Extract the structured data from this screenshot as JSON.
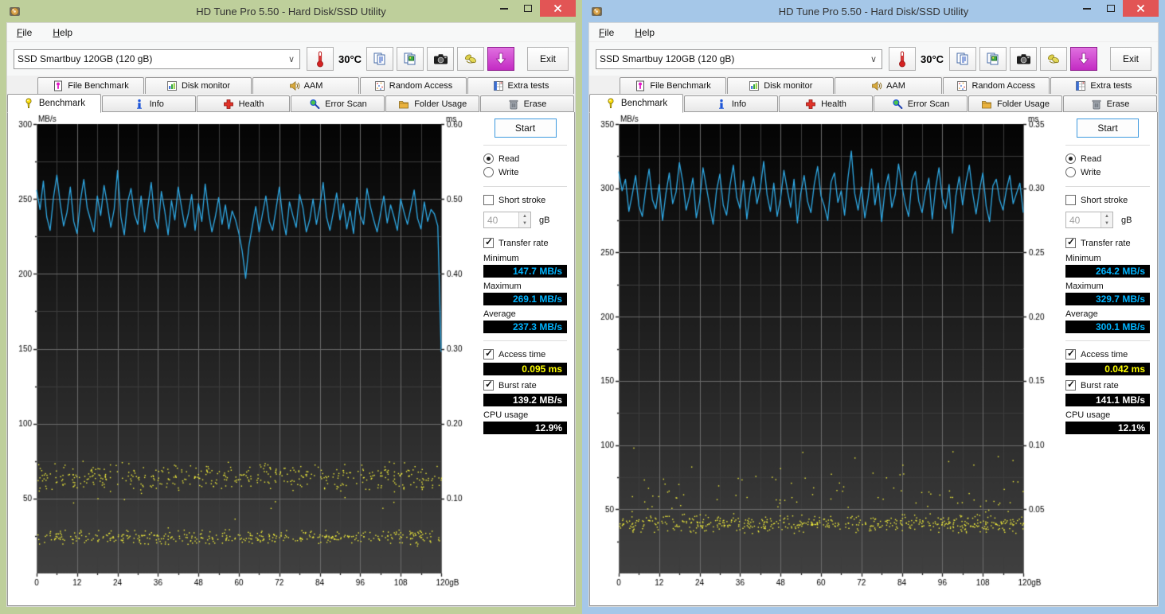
{
  "windows": [
    {
      "frame_color": "#becf9b",
      "title": "HD Tune Pro 5.50 - Hard Disk/SSD Utility",
      "menu": {
        "items": [
          {
            "label": "File"
          },
          {
            "label": "Help"
          }
        ]
      },
      "toolbar": {
        "drive_select": "SSD Smartbuy 120GB (120 gB)",
        "temperature": "30°C",
        "exit_label": "Exit"
      },
      "tabs_row1": [
        {
          "label": "File Benchmark"
        },
        {
          "label": "Disk monitor"
        },
        {
          "label": "AAM"
        },
        {
          "label": "Random Access"
        },
        {
          "label": "Extra tests"
        }
      ],
      "tabs_row2": [
        {
          "label": "Benchmark"
        },
        {
          "label": "Info"
        },
        {
          "label": "Health"
        },
        {
          "label": "Error Scan"
        },
        {
          "label": "Folder Usage"
        },
        {
          "label": "Erase"
        }
      ],
      "controls": {
        "start_label": "Start",
        "read_label": "Read",
        "write_label": "Write",
        "short_stroke_label": "Short stroke",
        "short_stroke_value": "40",
        "short_stroke_unit": "gB",
        "transfer_rate_label": "Transfer rate",
        "minimum_label": "Minimum",
        "minimum_value": "147.7 MB/s",
        "maximum_label": "Maximum",
        "maximum_value": "269.1 MB/s",
        "average_label": "Average",
        "average_value": "237.3 MB/s",
        "access_time_label": "Access time",
        "access_time_value": "0.095 ms",
        "burst_rate_label": "Burst rate",
        "burst_rate_value": "139.2 MB/s",
        "cpu_usage_label": "CPU usage",
        "cpu_usage_value": "12.9%"
      },
      "chart_data": {
        "type": "line+scatter",
        "x_unit": "gB",
        "x_max": 120,
        "x_ticks": [
          0,
          12,
          24,
          36,
          48,
          60,
          72,
          84,
          96,
          108,
          120
        ],
        "x_minor_step": 6,
        "y_left_label": "MB/s",
        "y_left_max": 300,
        "y_left_tick_step": 50,
        "y_left_minor_step": 25,
        "y_right_label": "ms",
        "y_right_max": 0.6,
        "y_right_ticks": [
          0.1,
          0.2,
          0.3,
          0.4,
          0.5,
          0.6
        ],
        "line_color": "#2fa9e5",
        "scatter_color": "#f5f13a",
        "seed": 11,
        "series": [
          {
            "name": "transfer-rate",
            "axis": "left",
            "x_step_gb": 1,
            "values": [
              256,
              243,
              262,
              238,
              229,
              251,
              266,
              247,
              232,
              241,
              258,
              235,
              227,
              249,
              263,
              244,
              236,
              228,
              252,
              239,
              259,
              246,
              231,
              243,
              269,
              238,
              226,
              248,
              257,
              240,
              233,
              252,
              228,
              245,
              261,
              237,
              230,
              255,
              242,
              226,
              249,
              236,
              258,
              244,
              231,
              240,
              253,
              229,
              247,
              235,
              260,
              241,
              228,
              238,
              251,
              233,
              246,
              230,
              242,
              236,
              227,
              215,
              197,
              219,
              232,
              245,
              228,
              240,
              252,
              235,
              229,
              243,
              258,
              237,
              226,
              248,
              239,
              231,
              253,
              244,
              228,
              236,
              250,
              233,
              245,
              261,
              238,
              229,
              241,
              254,
              236,
              247,
              230,
              242,
              227,
              251,
              239,
              233,
              257,
              245,
              236,
              228,
              240,
              252,
              234,
              246,
              238,
              229,
              250,
              241,
              233,
              244,
              256,
              237,
              230,
              248,
              235,
              243,
              240,
              232,
              148
            ]
          },
          {
            "name": "access-time-dots",
            "axis": "right",
            "type": "scatter-bands",
            "bands": [
              {
                "y": 0.13,
                "spread": 0.013,
                "count": 430
              },
              {
                "y": 0.049,
                "spread": 0.007,
                "count": 400
              },
              {
                "y": 0.095,
                "spread": 0.045,
                "count": 22
              }
            ]
          }
        ]
      }
    },
    {
      "frame_color": "#a5c7e8",
      "title": "HD Tune Pro 5.50 - Hard Disk/SSD Utility",
      "menu": {
        "items": [
          {
            "label": "File"
          },
          {
            "label": "Help"
          }
        ]
      },
      "toolbar": {
        "drive_select": "SSD Smartbuy 120GB (120 gB)",
        "temperature": "30°C",
        "exit_label": "Exit"
      },
      "tabs_row1": [
        {
          "label": "File Benchmark"
        },
        {
          "label": "Disk monitor"
        },
        {
          "label": "AAM"
        },
        {
          "label": "Random Access"
        },
        {
          "label": "Extra tests"
        }
      ],
      "tabs_row2": [
        {
          "label": "Benchmark"
        },
        {
          "label": "Info"
        },
        {
          "label": "Health"
        },
        {
          "label": "Error Scan"
        },
        {
          "label": "Folder Usage"
        },
        {
          "label": "Erase"
        }
      ],
      "controls": {
        "start_label": "Start",
        "read_label": "Read",
        "write_label": "Write",
        "short_stroke_label": "Short stroke",
        "short_stroke_value": "40",
        "short_stroke_unit": "gB",
        "transfer_rate_label": "Transfer rate",
        "minimum_label": "Minimum",
        "minimum_value": "264.2 MB/s",
        "maximum_label": "Maximum",
        "maximum_value": "329.7 MB/s",
        "average_label": "Average",
        "average_value": "300.1 MB/s",
        "access_time_label": "Access time",
        "access_time_value": "0.042 ms",
        "burst_rate_label": "Burst rate",
        "burst_rate_value": "141.1 MB/s",
        "cpu_usage_label": "CPU usage",
        "cpu_usage_value": "12.1%"
      },
      "chart_data": {
        "type": "line+scatter",
        "x_unit": "gB",
        "x_max": 120,
        "x_ticks": [
          0,
          12,
          24,
          36,
          48,
          60,
          72,
          84,
          96,
          108,
          120
        ],
        "x_minor_step": 6,
        "y_left_label": "MB/s",
        "y_left_max": 350,
        "y_left_tick_step": 50,
        "y_left_minor_step": 25,
        "y_right_label": "ms",
        "y_right_max": 0.35,
        "y_right_ticks": [
          0.05,
          0.1,
          0.15,
          0.2,
          0.25,
          0.3,
          0.35
        ],
        "line_color": "#2fa9e5",
        "scatter_color": "#f5f13a",
        "seed": 77,
        "series": [
          {
            "name": "transfer-rate",
            "axis": "left",
            "x_step_gb": 1,
            "values": [
              313,
              298,
              307,
              282,
              295,
              310,
              286,
              278,
              299,
              315,
              291,
              284,
              303,
              275,
              296,
              312,
              288,
              297,
              320,
              305,
              283,
              294,
              308,
              277,
              290,
              316,
              301,
              286,
              272,
              298,
              311,
              287,
              279,
              302,
              318,
              293,
              284,
              306,
              276,
              297,
              309,
              288,
              300,
              321,
              295,
              282,
              304,
              278,
              292,
              314,
              299,
              285,
              307,
              273,
              296,
              310,
              290,
              281,
              303,
              317,
              294,
              286,
              275,
              305,
              312,
              289,
              298,
              279,
              308,
              329,
              296,
              283,
              301,
              277,
              293,
              315,
              287,
              304,
              274,
              299,
              311,
              285,
              295,
              319,
              302,
              288,
              278,
              306,
              313,
              290,
              281,
              297,
              308,
              276,
              300,
              316,
              292,
              284,
              303,
              265,
              294,
              309,
              287,
              305,
              318,
              296,
              280,
              298,
              312,
              286,
              274,
              302,
              307,
              291,
              283,
              299,
              310,
              288,
              296,
              304,
              281
            ]
          },
          {
            "name": "access-time-dots",
            "axis": "right",
            "type": "scatter-bands",
            "bands": [
              {
                "y": 0.039,
                "spread": 0.005,
                "count": 520
              },
              {
                "y": 0.062,
                "spread": 0.018,
                "count": 95
              },
              {
                "y": 0.098,
                "spread": 0.01,
                "count": 6
              }
            ]
          }
        ]
      }
    }
  ]
}
